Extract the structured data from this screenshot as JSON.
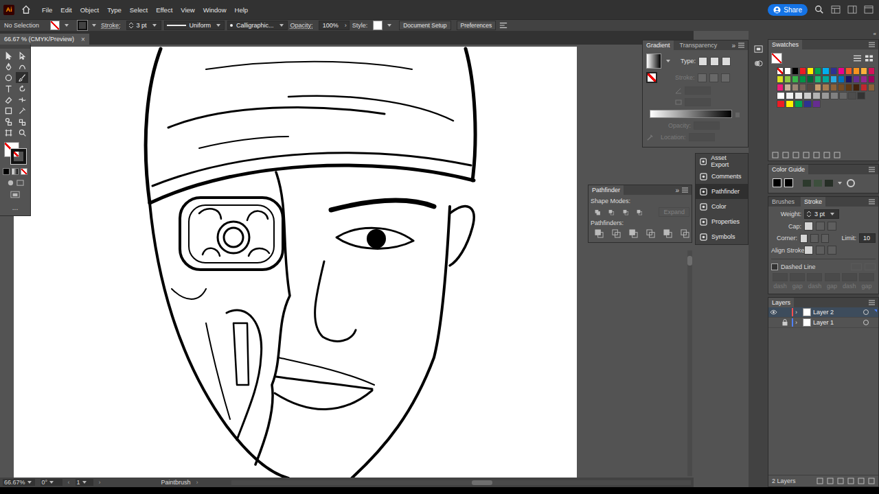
{
  "app": {
    "logo": "Ai"
  },
  "menu": [
    "File",
    "Edit",
    "Object",
    "Type",
    "Select",
    "Effect",
    "View",
    "Window",
    "Help"
  ],
  "share": "Share",
  "control_bar": {
    "selection": "No Selection",
    "stroke_label": "Stroke:",
    "stroke_weight": "3 pt",
    "profile": "Uniform",
    "brush": "Calligraphic...",
    "opacity_label": "Opacity:",
    "opacity": "100%",
    "style_label": "Style:",
    "buttons": [
      "Document Setup",
      "Preferences"
    ]
  },
  "document_tab": {
    "title": "66.67 % (CMYK/Preview)",
    "close": "×"
  },
  "toolbar": {
    "tools": [
      {
        "selected": false
      },
      {
        "selected": false
      },
      {
        "selected": false
      },
      {
        "selected": false
      },
      {
        "selected": false
      },
      {
        "selected": true
      },
      {
        "selected": false
      },
      {
        "selected": false
      },
      {
        "selected": false
      },
      {
        "selected": false
      },
      {
        "selected": false
      },
      {
        "selected": false
      },
      {
        "selected": false
      },
      {
        "selected": false
      },
      {
        "selected": false
      },
      {
        "selected": false
      }
    ],
    "more": "..."
  },
  "gradient_panel": {
    "tabs": [
      {
        "label": "Gradient",
        "selected": true
      },
      {
        "label": "Transparency",
        "selected": false
      }
    ],
    "type": {
      "label": "Type:",
      "disabled": false
    },
    "stroke": {
      "label": "Stroke:",
      "disabled": true
    },
    "opacity": {
      "label": "Opacity:",
      "disabled": true
    },
    "location": {
      "label": "Location:",
      "disabled": true
    }
  },
  "collapsed_panels": [
    {
      "label": "Asset Export",
      "selected": false
    },
    {
      "label": "Comments",
      "selected": false
    },
    {
      "label": "Pathfinder",
      "selected": true
    },
    {
      "label": "Color",
      "selected": false
    },
    {
      "label": "Properties",
      "selected": false
    },
    {
      "label": "Symbols",
      "selected": false
    }
  ],
  "pathfinder": {
    "title": "Pathfinder",
    "shape_modes": "Shape Modes:",
    "expand": "Expand",
    "pathfinders": "Pathfinders:"
  },
  "swatches": {
    "title": "Swatches",
    "rows": [
      [
        "none",
        "#ffffff",
        "#000000",
        "#ed1c24",
        "#fff200",
        "#00a651",
        "#00aeef",
        "#2e3192",
        "#ec008c",
        "#f15a24",
        "#f7931e",
        "#fbb03b",
        "#d4145a"
      ],
      [
        "#d9e021",
        "#8cc63f",
        "#39b54a",
        "#009245",
        "#006837",
        "#22b573",
        "#00a99d",
        "#29abe2",
        "#0071bc",
        "#1b1464",
        "#662d91",
        "#93278f",
        "#9e005d"
      ],
      [
        "#ed1e79",
        "#c7b299",
        "#998675",
        "#736357",
        "#534741",
        "#c69c6d",
        "#a67c52",
        "#8c6239",
        "#754c24",
        "#603813",
        "#42210b",
        "#c1272d",
        "#8c6239"
      ],
      [
        "#ffffff",
        "#f2f2f2",
        "#e6e6e6",
        "#cccccc",
        "#b3b3b3",
        "#999999",
        "#808080",
        "#666666",
        "#4d4d4d",
        "#333333"
      ],
      [
        "#ed1c24",
        "#fff200",
        "#00a651",
        "#2e3192",
        "#662d91"
      ]
    ]
  },
  "color_guide": {
    "title": "Color Guide",
    "colors": [
      "#000000",
      "#000000",
      "#2d3a2d",
      "#3d4f3d",
      "#262e26"
    ]
  },
  "stroke_panel": {
    "tabs": [
      {
        "label": "Brushes",
        "selected": false
      },
      {
        "label": "Stroke",
        "selected": true
      }
    ],
    "weight_label": "Weight:",
    "weight": "3 pt",
    "cap_label": "Cap:",
    "corner_label": "Corner:",
    "limit_label": "Limit:",
    "limit": "10",
    "align_label": "Align Stroke:",
    "dashed_label": "Dashed Line",
    "dashed": false,
    "dash_fields": [
      "dash",
      "gap",
      "dash",
      "gap",
      "dash",
      "gap"
    ]
  },
  "layers": {
    "title": "Layers",
    "items": [
      {
        "name": "Layer 2",
        "selected": true,
        "visible": true,
        "locked": false,
        "color": "#ff4f4f"
      },
      {
        "name": "Layer 1",
        "selected": false,
        "visible": false,
        "locked": true,
        "color": "#4f80ff"
      }
    ],
    "count": "2 Layers"
  },
  "status_bar": {
    "zoom": "66.67%",
    "rotation": "0°",
    "artboard": "1",
    "tool": "Paintbrush"
  }
}
